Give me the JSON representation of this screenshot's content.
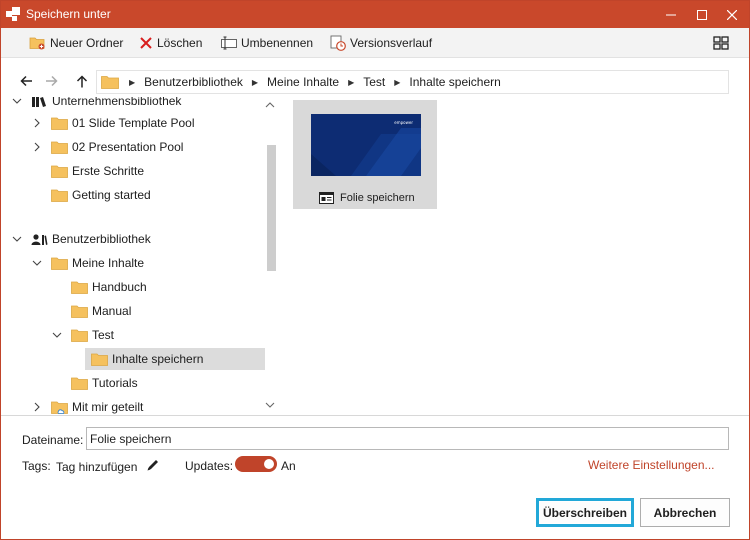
{
  "window": {
    "title": "Speichern unter",
    "accent_color": "#c9482b",
    "focus_color": "#22a8d8"
  },
  "toolbar": {
    "new_folder_label": "Neuer Ordner",
    "delete_label": "Löschen",
    "rename_label": "Umbenennen",
    "version_history_label": "Versionsverlauf"
  },
  "navigation": {
    "breadcrumbs": [
      "Benutzerbibliothek",
      "Meine Inhalte",
      "Test",
      "Inhalte speichern"
    ]
  },
  "tree": {
    "items": [
      {
        "label": "Unternehmensbibliothek",
        "icon": "library-icon",
        "state": "expanded"
      },
      {
        "label": "01 Slide Template Pool",
        "icon": "folder-icon",
        "state": "collapsed"
      },
      {
        "label": "02 Presentation Pool",
        "icon": "folder-icon",
        "state": "collapsed"
      },
      {
        "label": "Erste Schritte",
        "icon": "folder-icon",
        "state": "none"
      },
      {
        "label": "Getting started",
        "icon": "folder-icon",
        "state": "none"
      },
      {
        "label": "Benutzerbibliothek",
        "icon": "user-library-icon",
        "state": "expanded"
      },
      {
        "label": "Meine Inhalte",
        "icon": "folder-icon",
        "state": "expanded"
      },
      {
        "label": "Handbuch",
        "icon": "folder-icon",
        "state": "none"
      },
      {
        "label": "Manual",
        "icon": "folder-icon",
        "state": "none"
      },
      {
        "label": "Test",
        "icon": "folder-icon",
        "state": "expanded"
      },
      {
        "label": "Inhalte speichern",
        "icon": "folder-icon",
        "state": "selected"
      },
      {
        "label": "Tutorials",
        "icon": "folder-icon",
        "state": "none"
      },
      {
        "label": "Mit mir geteilt",
        "icon": "shared-folder-icon",
        "state": "collapsed"
      }
    ]
  },
  "content": {
    "items": [
      {
        "label": "Folie speichern",
        "thumbnail_brand": "empower",
        "icon": "slide-icon"
      }
    ]
  },
  "form": {
    "filename_label": "Dateiname:",
    "filename_value": "Folie speichern",
    "tags_label": "Tags:",
    "tags_value": "Tag hinzufügen",
    "updates_label": "Updates:",
    "updates_state": "An",
    "updates_enabled": true,
    "more_settings_label": "Weitere Einstellungen..."
  },
  "buttons": {
    "overwrite_label": "Überschreiben",
    "cancel_label": "Abbrechen"
  }
}
